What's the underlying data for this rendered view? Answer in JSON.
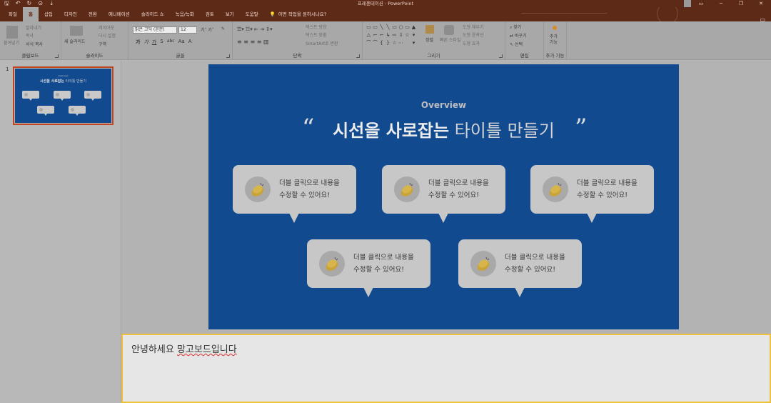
{
  "window": {
    "title": "프레젠테이션 - PowerPoint",
    "qat": [
      "🖫",
      "↶",
      "↻",
      "⊙",
      "⇣"
    ],
    "controls": [
      "▭",
      "─",
      "❐",
      "✕"
    ]
  },
  "tabs": [
    {
      "label": "파일"
    },
    {
      "label": "홈",
      "active": true
    },
    {
      "label": "삽입"
    },
    {
      "label": "디자인"
    },
    {
      "label": "전환"
    },
    {
      "label": "애니메이션"
    },
    {
      "label": "슬라이드 쇼"
    },
    {
      "label": "녹음/녹화"
    },
    {
      "label": "검토"
    },
    {
      "label": "보기"
    },
    {
      "label": "도움말"
    }
  ],
  "tell_me": "어떤 작업을 원하시나요?",
  "ribbon": {
    "clipboard": {
      "label": "클립보드",
      "paste": "붙여넣기",
      "cut": "잘라내기",
      "copy": "복사",
      "format_painter": "서식 복사"
    },
    "slides": {
      "label": "슬라이드",
      "new_slide": "새 슬라이드",
      "layout": "레이아웃",
      "reset": "다시 설정",
      "section": "구역"
    },
    "font": {
      "label": "글꼴",
      "font_name": "맑은 고딕 (본문)",
      "font_size": "12",
      "bold": "가",
      "italic": "가",
      "underline": "가",
      "strike": "S",
      "spacing": "abc",
      "case": "Aa"
    },
    "paragraph": {
      "label": "단락",
      "text_direction": "텍스트 방향",
      "align_text": "텍스트 맞춤",
      "smartart": "SmartArt로 변환"
    },
    "drawing": {
      "label": "그리기",
      "arrange": "정렬",
      "quick_styles": "빠른 스타일",
      "shape_fill": "도형 채우기",
      "shape_outline": "도형 윤곽선",
      "shape_effects": "도형 효과"
    },
    "editing": {
      "label": "편집",
      "find": "찾기",
      "replace": "바꾸기",
      "select": "선택"
    },
    "addins": {
      "label": "추가 기능",
      "button": "추가\n기능"
    }
  },
  "slide_panel": {
    "number": "1"
  },
  "slide": {
    "eyebrow": "Overview",
    "open_quote": "“",
    "close_quote": "”",
    "title_bold": "시선을 사로잡는",
    "title_light": "타이틀 만들기",
    "cards": [
      {
        "line1": "더블 클릭으로 내용을",
        "line2": "수정할 수 있어요!"
      },
      {
        "line1": "더블 클릭으로 내용을",
        "line2": "수정할 수 있어요!"
      },
      {
        "line1": "더블 클릭으로 내용을",
        "line2": "수정할 수 있어요!"
      },
      {
        "line1": "더블 클릭으로 내용을",
        "line2": "수정할 수 있어요!"
      },
      {
        "line1": "더블 클릭으로 내용을",
        "line2": "수정할 수 있어요!"
      }
    ]
  },
  "notes": {
    "text_plain": "안녕하세요 ",
    "text_marked": "망고보드입니다"
  },
  "colors": {
    "accent": "#c0451f",
    "slide_bg": "#124a90",
    "notes_border": "#f0c23b"
  }
}
